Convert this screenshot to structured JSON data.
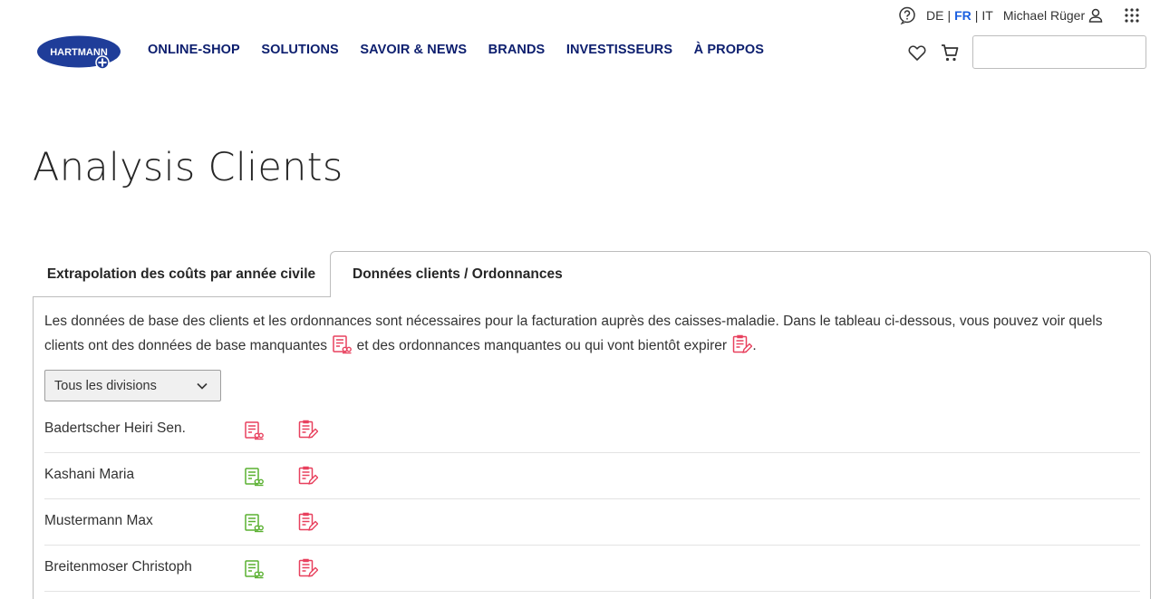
{
  "header": {
    "logo_text": "HARTMANN",
    "nav": [
      "ONLINE-SHOP",
      "SOLUTIONS",
      "SAVOIR & NEWS",
      "BRANDS",
      "INVESTISSEURS",
      "À PROPOS"
    ],
    "languages": [
      "DE",
      "FR",
      "IT"
    ],
    "active_language": "FR",
    "user_name": "Michael Rüger",
    "search_value": "",
    "icons": {
      "help": "help-icon",
      "user": "user-icon",
      "apps": "apps-grid-icon",
      "wishlist": "heart-icon",
      "cart": "cart-icon"
    }
  },
  "page": {
    "title": "Analysis Clients"
  },
  "tabs": [
    {
      "label": "Extrapolation des coûts par année civile",
      "active": false
    },
    {
      "label": "Données clients / Ordonnances",
      "active": true
    }
  ],
  "content": {
    "description_part1": "Les données de base des clients et les ordonnances sont nécessaires pour la facturation auprès des caisses-maladie. Dans le tableau ci-dessous, vous pouvez voir quels clients ont des données de base manquantes",
    "description_part2": "et des ordonnances manquantes ou qui vont bientôt expirer",
    "description_end": ".",
    "division_select": "Tous les divisions",
    "clients": [
      {
        "name": "Badertscher Heiri Sen.",
        "master_data_status": "missing",
        "prescription_status": "missing"
      },
      {
        "name": "Kashani Maria",
        "master_data_status": "ok",
        "prescription_status": "missing"
      },
      {
        "name": "Mustermann Max",
        "master_data_status": "ok",
        "prescription_status": "missing"
      },
      {
        "name": "Breitenmoser Christoph",
        "master_data_status": "ok",
        "prescription_status": "missing"
      }
    ]
  },
  "colors": {
    "nav": "#0c1e6e",
    "brand_blue": "#1f3d99",
    "active_lang": "#1a5fe0",
    "status_missing": "#e8415e",
    "status_ok": "#5ab031"
  }
}
